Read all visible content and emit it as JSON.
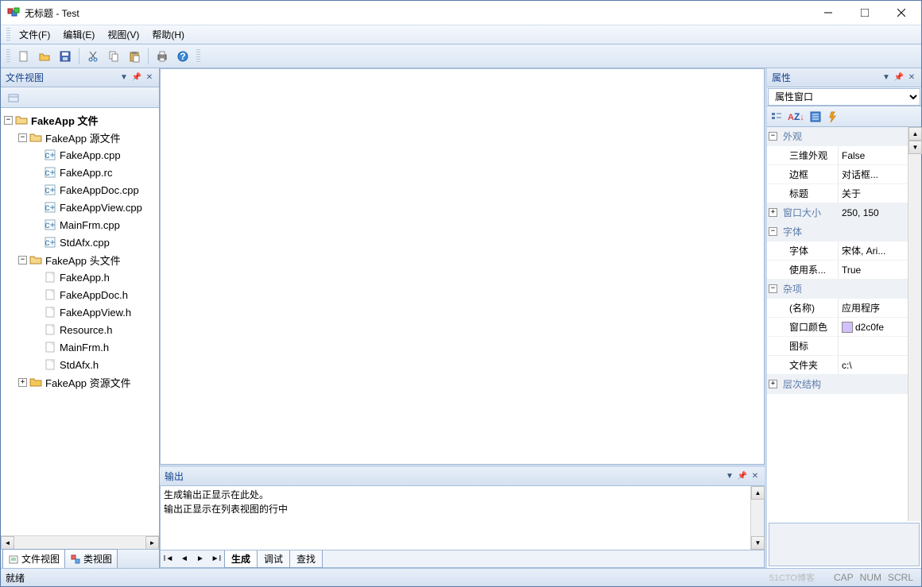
{
  "window": {
    "title": "无标题 - Test"
  },
  "menus": {
    "file": "文件(F)",
    "edit": "编辑(E)",
    "view": "视图(V)",
    "help": "帮助(H)"
  },
  "toolbar_icons": {
    "new": "new-file-icon",
    "open": "open-folder-icon",
    "save": "save-icon",
    "cut": "cut-icon",
    "copy": "copy-icon",
    "paste": "paste-icon",
    "print": "print-icon",
    "help": "help-icon"
  },
  "file_view": {
    "title": "文件视图",
    "root": "FakeApp 文件",
    "groups": [
      {
        "label": "FakeApp 源文件",
        "files": [
          "FakeApp.cpp",
          "FakeApp.rc",
          "FakeAppDoc.cpp",
          "FakeAppView.cpp",
          "MainFrm.cpp",
          "StdAfx.cpp"
        ]
      },
      {
        "label": "FakeApp 头文件",
        "files": [
          "FakeApp.h",
          "FakeAppDoc.h",
          "FakeAppView.h",
          "Resource.h",
          "MainFrm.h",
          "StdAfx.h"
        ]
      },
      {
        "label": "FakeApp 资源文件",
        "collapsed": true
      }
    ],
    "tabs": {
      "file_view": "文件视图",
      "class_view": "类视图"
    }
  },
  "output": {
    "title": "输出",
    "lines": [
      "生成输出正显示在此处。",
      "输出正显示在列表视图的行中"
    ],
    "tabs": {
      "build": "生成",
      "debug": "调试",
      "find": "查找"
    }
  },
  "properties": {
    "title": "属性",
    "combo": "属性窗口",
    "groups": [
      {
        "name": "外观",
        "expanded": true,
        "rows": [
          {
            "name": "三维外观",
            "value": "False"
          },
          {
            "name": "边框",
            "value": "对话框..."
          },
          {
            "name": "标题",
            "value": "关于"
          }
        ]
      },
      {
        "name": "窗口大小",
        "expanded": false,
        "inline_value": "250, 150"
      },
      {
        "name": "字体",
        "expanded": true,
        "rows": [
          {
            "name": "字体",
            "value": "宋体, Ari..."
          },
          {
            "name": "使用系...",
            "value": "True"
          }
        ]
      },
      {
        "name": "杂项",
        "expanded": true,
        "rows": [
          {
            "name": "(名称)",
            "value": "应用程序"
          },
          {
            "name": "窗口颜色",
            "value": "d2c0fe",
            "color": "#d2c0fe"
          },
          {
            "name": "图标",
            "value": ""
          },
          {
            "name": "文件夹",
            "value": "c:\\"
          }
        ]
      },
      {
        "name": "层次结构",
        "expanded": false
      }
    ]
  },
  "status": {
    "text": "就绪",
    "cap": "CAP",
    "num": "NUM",
    "scrl": "SCRL"
  },
  "watermark": "51CTO博客"
}
